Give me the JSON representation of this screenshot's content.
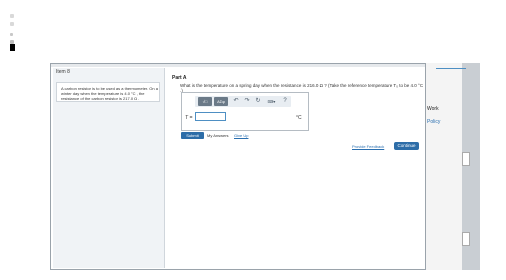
{
  "item": {
    "title": "Item 8",
    "problem": "A carbon resistor is to be used as a thermometer. On a winter day when the temperature is 4.0 °C , the resistance of the carbon resistor is 217.0 Ω ."
  },
  "part": {
    "label": "Part A",
    "question": "What is the temperature on a spring day when the resistance is 216.0 Ω ? (Take the reference temperature T₀ to be 4.0 °C .)"
  },
  "toolbar": {
    "template_label": "ΑΣφ",
    "sqrt_label": "√□",
    "undo_icon": "undo-icon",
    "redo_icon": "redo-icon",
    "reset_icon": "reset-icon",
    "keyboard_icon": "keyboard-icon",
    "help_icon": "help-icon"
  },
  "answer": {
    "variable": "T =",
    "value": "",
    "unit": "°C"
  },
  "actions": {
    "submit": "Submit",
    "my_answers": "My Answers",
    "give_up": "Give Up",
    "feedback": "Provide Feedback",
    "continue": "Continue"
  },
  "background": {
    "work_label": "Work",
    "policy_label": "Policy"
  },
  "colors": {
    "accent": "#2d6da8",
    "link": "#2a6fb0",
    "panel_bg": "#f0f3f6"
  }
}
